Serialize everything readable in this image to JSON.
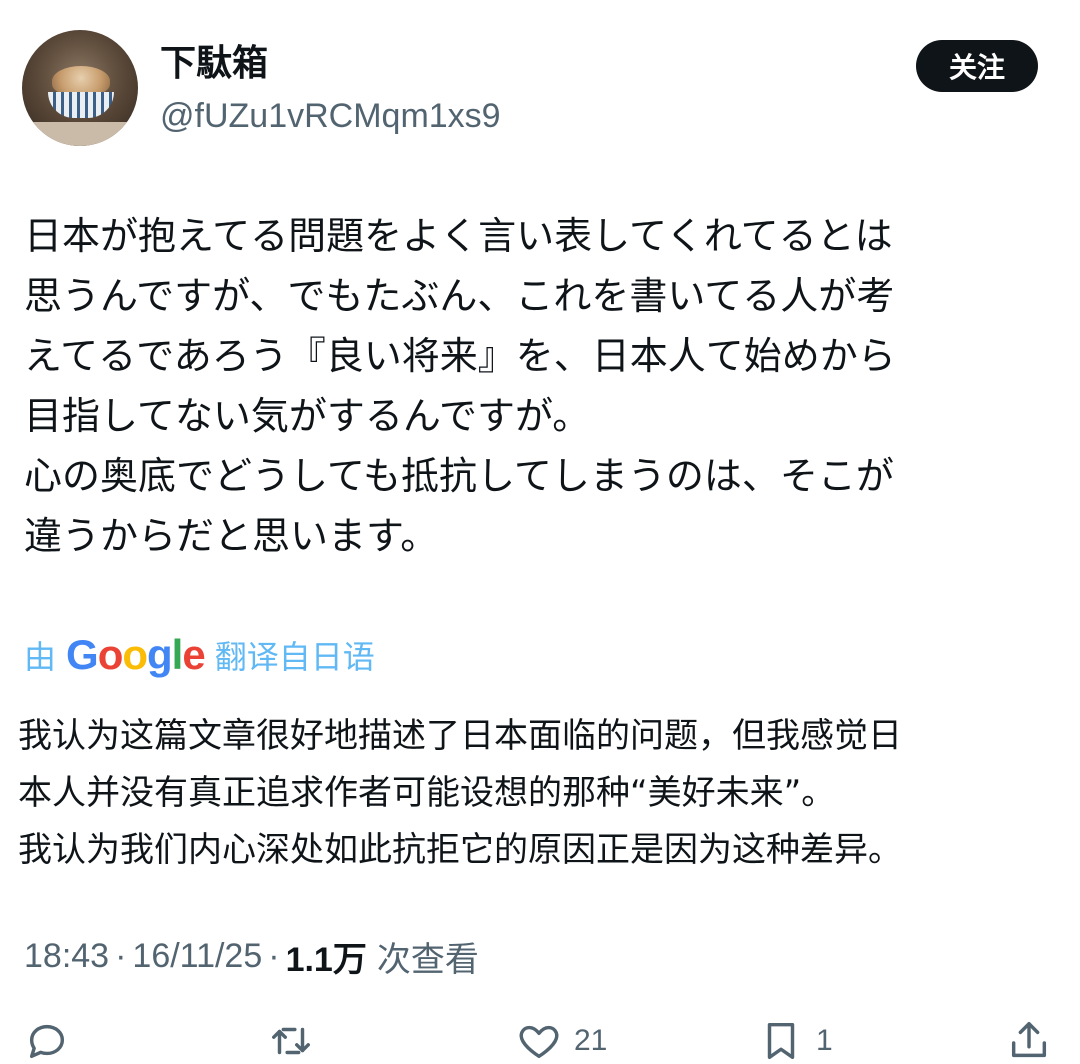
{
  "user": {
    "display_name": "下駄箱",
    "handle": "@fUZu1vRCMqm1xs9",
    "follow_label": "关注"
  },
  "tweet": {
    "text": "日本が抱えてる問題をよく言い表してくれてるとは\n思うんですが、でもたぶん、これを書いてる人が考\nえてるであろう『良い将来』を、日本人て始めから\n目指してない気がするんですが。\n心の奥底でどうしても抵抗してしまうのは、そこが\n違うからだと思います。"
  },
  "translation": {
    "by": "由",
    "provider_letters": [
      "G",
      "o",
      "o",
      "g",
      "l",
      "e"
    ],
    "action": "翻译自日语",
    "text": "我认为这篇文章很好地描述了日本面临的问题，但我感觉日\n本人并没有真正追求作者可能设想的那种“美好未来”。\n我认为我们内心深处如此抗拒它的原因正是因为这种差异。"
  },
  "meta": {
    "time": "18:43",
    "date": "16/11/25",
    "separator": "·",
    "views_count": "1.1万",
    "views_label": "次查看"
  },
  "actions": {
    "reply_count": "",
    "retweet_count": "",
    "like_count": "21",
    "bookmark_count": "1"
  },
  "icons": {
    "reply": "reply-icon",
    "retweet": "retweet-icon",
    "like": "heart-icon",
    "bookmark": "bookmark-icon",
    "share": "share-icon"
  },
  "colors": {
    "accent": "#1d9bf0",
    "text": "#0f1419",
    "secondary": "#536471",
    "button_bg": "#0f1419"
  }
}
